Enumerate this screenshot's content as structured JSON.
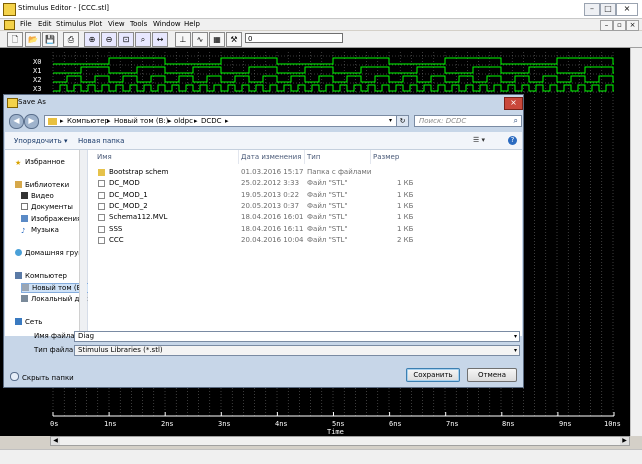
{
  "window": {
    "title": "Stimulus Editor - [CCC.stl]"
  },
  "menu": {
    "items": [
      "File",
      "Edit",
      "Stimulus",
      "Plot",
      "View",
      "Tools",
      "Window",
      "Help"
    ]
  },
  "toolbar": {
    "input_value": "0"
  },
  "signals": [
    "X0",
    "X1",
    "X2",
    "X3"
  ],
  "axis": {
    "ticks": [
      "0s",
      "1ns",
      "2ns",
      "3ns",
      "4ns",
      "5ns",
      "6ns",
      "7ns",
      "8ns",
      "9ns",
      "10ns"
    ],
    "title": "Time"
  },
  "dialog": {
    "title": "Save As",
    "breadcrumb": [
      "Компьютер",
      "Новый том (B:)",
      "oldpc",
      "DCDC"
    ],
    "search_placeholder": "Поиск: DCDC",
    "commands": {
      "organize": "Упорядочить ▾",
      "new_folder": "Новая папка"
    },
    "nav": {
      "favorites": "Избранное",
      "libraries": "Библиотеки",
      "library_items": [
        "Видео",
        "Документы",
        "Изображения",
        "Музыка"
      ],
      "homegroup": "Домашняя группа",
      "computer": "Компьютер",
      "drives": [
        "Новый том (B:)",
        "Локальный диск"
      ],
      "network": "Сеть"
    },
    "columns": {
      "name": "Имя",
      "date": "Дата изменения",
      "type": "Тип",
      "size": "Размер"
    },
    "files": [
      {
        "name": "Bootstrap schem",
        "date": "01.03.2016 15:17",
        "type": "Папка с файлами",
        "size": "",
        "kind": "folder"
      },
      {
        "name": "DC_MOD",
        "date": "25.02.2012 3:33",
        "type": "Файл \"STL\"",
        "size": "1 КБ",
        "kind": "file"
      },
      {
        "name": "DC_MOD_1",
        "date": "19.05.2013 0:22",
        "type": "Файл \"STL\"",
        "size": "1 КБ",
        "kind": "file"
      },
      {
        "name": "DC_MOD_2",
        "date": "20.05.2013 0:37",
        "type": "Файл \"STL\"",
        "size": "1 КБ",
        "kind": "file"
      },
      {
        "name": "Schema112.MVL",
        "date": "18.04.2016 16:01",
        "type": "Файл \"STL\"",
        "size": "1 КБ",
        "kind": "file"
      },
      {
        "name": "SSS",
        "date": "18.04.2016 16:11",
        "type": "Файл \"STL\"",
        "size": "1 КБ",
        "kind": "file"
      },
      {
        "name": "CCC",
        "date": "20.04.2016 10:04",
        "type": "Файл \"STL\"",
        "size": "2 КБ",
        "kind": "file"
      }
    ],
    "filename_label": "Имя файла:",
    "filename_value": "Diag",
    "filetype_label": "Тип файла:",
    "filetype_value": "Stimulus Libraries (*.stl)",
    "hide_folders": "Скрыть папки",
    "save_button": "Сохранить",
    "cancel_button": "Отмена"
  }
}
